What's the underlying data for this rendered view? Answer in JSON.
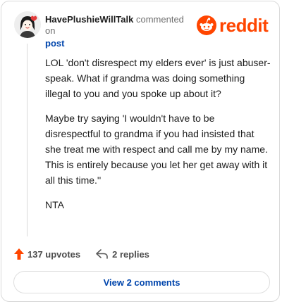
{
  "comment": {
    "username": "HavePlushieWillTalk",
    "action_text": "commented on",
    "post_link": "post",
    "paragraphs": [
      "LOL 'don't disrespect my elders ever' is just abuser-speak. What if grandma was doing something illegal to you and you spoke up about it?",
      "Maybe try saying 'I wouldn't have to be disrespectful to grandma if you had insisted that she treat me with respect and call me by my name. This is entirely because you let her get away with it all this time.''",
      "NTA"
    ]
  },
  "brand": {
    "name": "reddit",
    "color": "#ff4500"
  },
  "footer": {
    "upvotes_label": "137 upvotes",
    "replies_label": "2 replies",
    "view_comments_label": "View 2 comments"
  },
  "icons": {
    "avatar": "avatar-icon",
    "logo": "reddit-snoo-icon",
    "upvote": "upvote-arrow-icon",
    "reply": "reply-arrow-icon"
  }
}
